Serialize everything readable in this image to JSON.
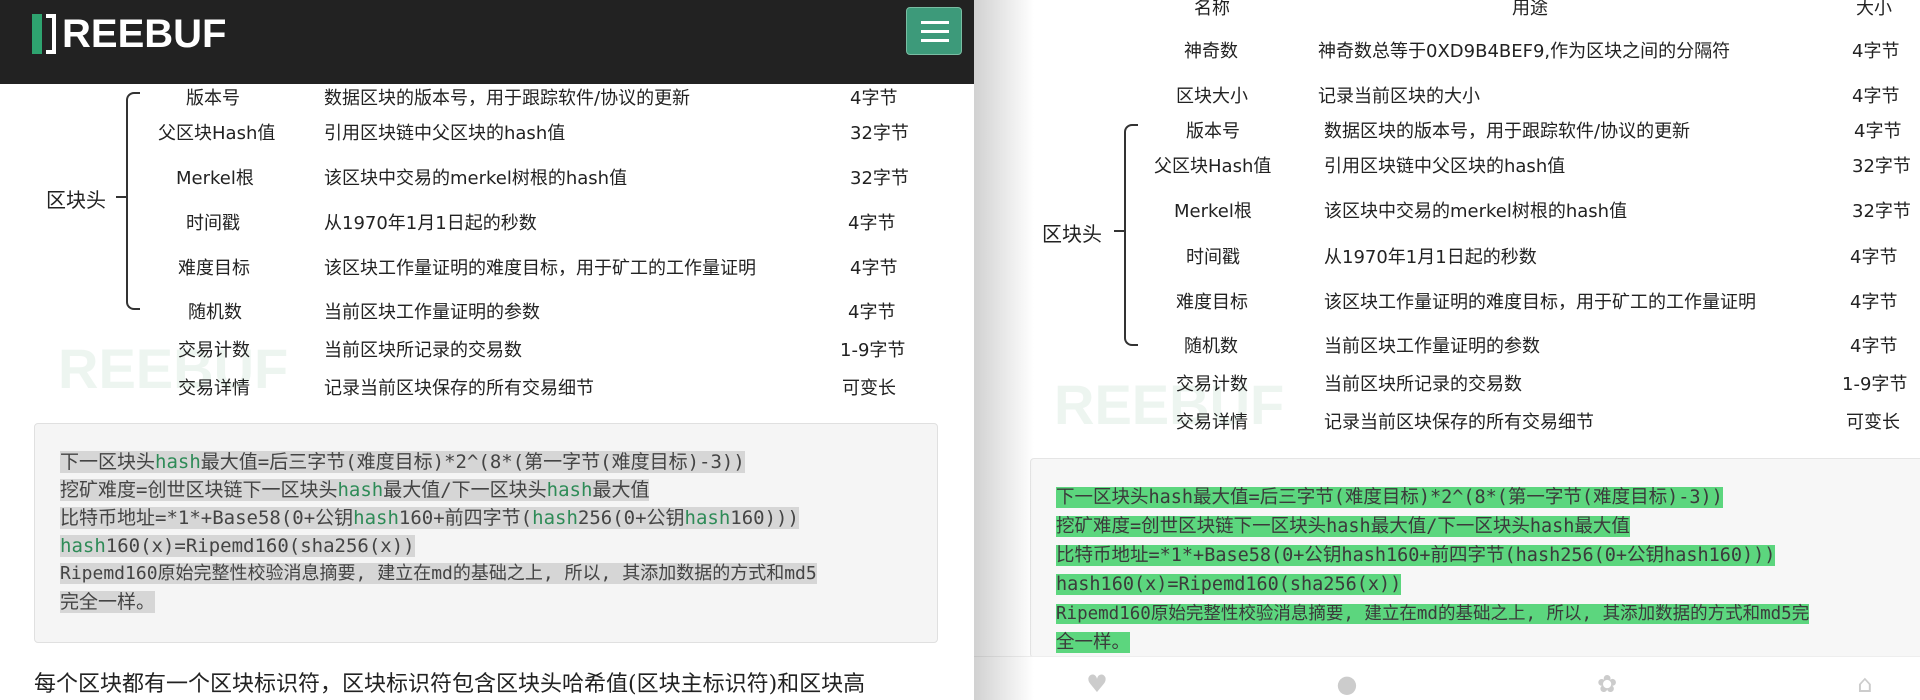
{
  "header": {
    "logo_text": "REEBUF",
    "menu_icon": "hamburger-menu-icon",
    "brand_color": "#2ea36f",
    "menu_button_color": "#3d9a7a"
  },
  "table_header": {
    "name": "名称",
    "use": "用途",
    "size": "大小"
  },
  "magic_row": {
    "name": "神奇数",
    "use": "神奇数总等于0XD9B4BEF9,作为区块之间的分隔符",
    "size": "4字节"
  },
  "blocksize_row": {
    "name": "区块大小",
    "use": "记录当前区块的大小",
    "size": "4字节"
  },
  "group_label": "区块头",
  "rows": [
    {
      "name": "版本号",
      "use": "数据区块的版本号，用于跟踪软件/协议的更新",
      "size": "4字节"
    },
    {
      "name": "父区块Hash值",
      "use": "引用区块链中父区块的hash值",
      "size": "32字节"
    },
    {
      "name": "Merkel根",
      "use": "该区块中交易的merkel树根的hash值",
      "size": "32字节"
    },
    {
      "name": "时间戳",
      "use": "从1970年1月1日起的秒数",
      "size": "4字节"
    },
    {
      "name": "难度目标",
      "use": "该区块工作量证明的难度目标，用于矿工的工作量证明",
      "size": "4字节"
    },
    {
      "name": "随机数",
      "use": "当前区块工作量证明的参数",
      "size": "4字节"
    },
    {
      "name": "交易计数",
      "use": "当前区块所记录的交易数",
      "size": "1-9字节"
    },
    {
      "name": "交易详情",
      "use": "记录当前区块保存的所有交易细节",
      "size": "可变长"
    }
  ],
  "watermark": "REEBUF",
  "code": {
    "line1": {
      "a": "下一区块头",
      "b": "hash",
      "c": "最大值=后三字节(难度目标)*2^(8*(第一字节(难度目标)-3))"
    },
    "line2": {
      "a": "挖矿难度=创世区块链下一区块头",
      "b": "hash",
      "c": "最大值/下一区块头",
      "d": "hash",
      "e": "最大值"
    },
    "line3": {
      "a": "比特币地址=*1*+Base58(0+公钥",
      "b": "hash",
      "c": "160+前四字节(",
      "d": "hash",
      "e": "256(0+公钥",
      "f": "hash",
      "g": "160)))"
    },
    "line4": {
      "a": "hash",
      "b": "160(x)=Ripemd160(sha256(x))"
    },
    "line5": "Ripemd160原始完整性校验消息摘要, 建立在md的基础之上, 所以, 其添加数据的方式和md5",
    "line6": "完全一样。"
  },
  "code_right": {
    "line1": "下一区块头hash最大值=后三字节(难度目标)*2^(8*(第一字节(难度目标)-3))",
    "line2": "挖矿难度=创世区块链下一区块头hash最大值/下一区块头hash最大值",
    "line3": "比特币地址=*1*+Base58(0+公钥hash160+前四字节(hash256(0+公钥hash160)))",
    "line4": "hash160(x)=Ripemd160(sha256(x))",
    "line5": "Ripemd160原始完整性校验消息摘要, 建立在md的基础之上, 所以, 其添加数据的方式和md5完",
    "line6": "全一样。"
  },
  "paragraph": "每个区块都有一个区块标识符，区块标识符包含区块头哈希值(区块主标识符)和区块高",
  "bottom_icons": [
    "heart-icon",
    "user-icon",
    "gear-icon",
    "home-icon"
  ],
  "colors": {
    "selection_gray": "#d6d6d6",
    "selection_green": "#5cd67e",
    "keyword_green": "#2e8b57"
  }
}
